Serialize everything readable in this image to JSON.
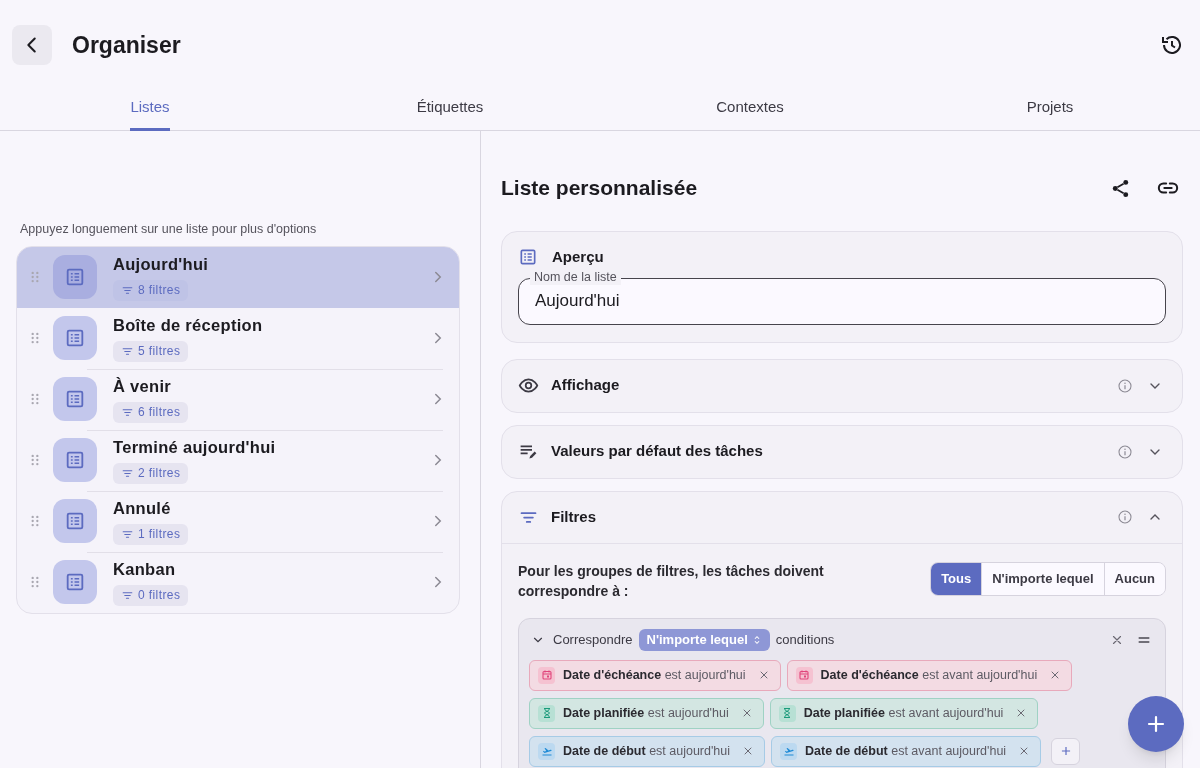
{
  "header": {
    "title": "Organiser"
  },
  "tabs": [
    {
      "label": "Listes",
      "selected": true
    },
    {
      "label": "Étiquettes",
      "selected": false
    },
    {
      "label": "Contextes",
      "selected": false
    },
    {
      "label": "Projets",
      "selected": false
    }
  ],
  "lists": {
    "hint": "Appuyez longuement sur une liste pour plus d'options",
    "items": [
      {
        "name": "Aujourd'hui",
        "filters": "8 filtres",
        "selected": true
      },
      {
        "name": "Boîte de réception",
        "filters": "5 filtres",
        "selected": false
      },
      {
        "name": "À venir",
        "filters": "6 filtres",
        "selected": false
      },
      {
        "name": "Terminé aujourd'hui",
        "filters": "2 filtres",
        "selected": false
      },
      {
        "name": "Annulé",
        "filters": "1 filtres",
        "selected": false
      },
      {
        "name": "Kanban",
        "filters": "0 filtres",
        "selected": false
      }
    ]
  },
  "editor": {
    "title": "Liste personnalisée",
    "overview": {
      "title": "Aperçu",
      "field_label": "Nom de la liste",
      "value": "Aujourd'hui"
    },
    "sections": [
      {
        "kind": "display",
        "title": "Affichage",
        "expanded": false
      },
      {
        "kind": "defaults",
        "title": "Valeurs par défaut des tâches",
        "expanded": false
      },
      {
        "kind": "filters",
        "title": "Filtres",
        "expanded": true
      }
    ],
    "filters": {
      "prompt": "Pour les groupes de filtres, les tâches doivent correspondre à :",
      "options": [
        {
          "label": "Tous",
          "selected": true
        },
        {
          "label": "N'importe lequel",
          "selected": false
        },
        {
          "label": "Aucun",
          "selected": false
        }
      ],
      "group": {
        "expanded": true,
        "prefix": "Correspondre",
        "mode": "N'importe lequel",
        "suffix": "conditions",
        "rows": [
          [
            {
              "kind": "due",
              "field": "Date d'échéance",
              "condition": "est aujourd'hui"
            },
            {
              "kind": "due",
              "field": "Date d'échéance",
              "condition": "est avant aujourd'hui"
            }
          ],
          [
            {
              "kind": "scheduled",
              "field": "Date planifiée",
              "condition": "est aujourd'hui"
            },
            {
              "kind": "scheduled",
              "field": "Date planifiée",
              "condition": "est avant aujourd'hui"
            }
          ],
          [
            {
              "kind": "start",
              "field": "Date de début",
              "condition": "est aujourd'hui"
            },
            {
              "kind": "start",
              "field": "Date de début",
              "condition": "est avant aujourd'hui"
            }
          ]
        ]
      }
    }
  }
}
